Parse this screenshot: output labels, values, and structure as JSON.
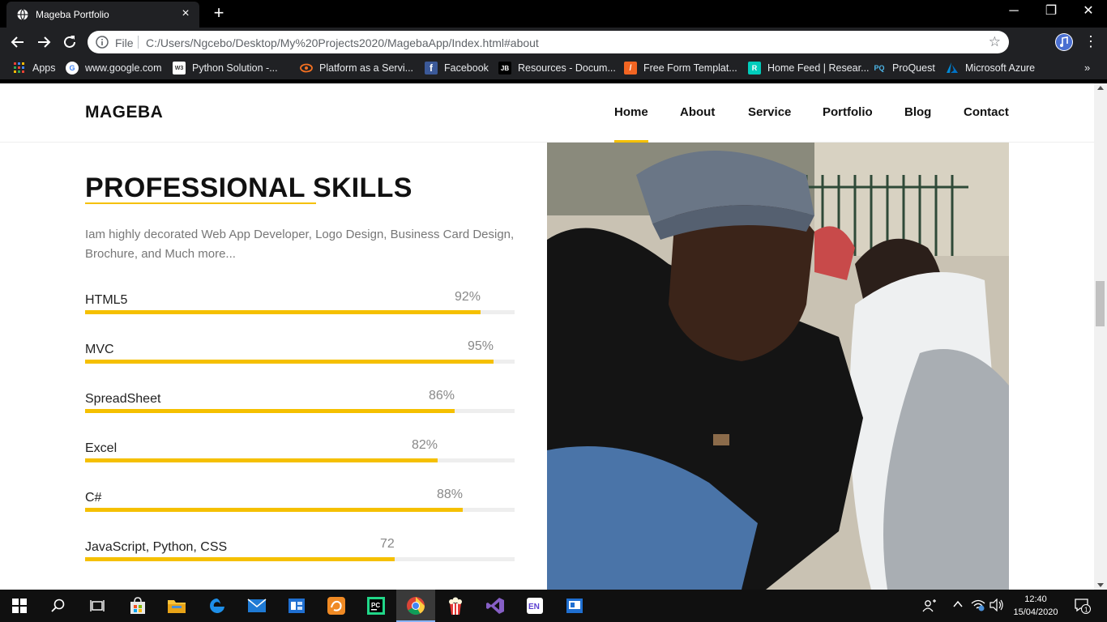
{
  "browser": {
    "tab_title": "Mageba Portfolio",
    "tab_close": "×",
    "new_tab": "+",
    "window_controls": {
      "minimize": "─",
      "restore": "❐",
      "close": "✕"
    },
    "address": {
      "scheme_label": "File",
      "url": "C:/Users/Ngcebo/Desktop/My%20Projects2020/MagebaApp/Index.html#about"
    },
    "star": "☆",
    "more": "⋮",
    "bookmarks": [
      {
        "label": "Apps",
        "icon": "apps-grid-icon",
        "color": "#ea4335"
      },
      {
        "label": "www.google.com",
        "icon": "google-icon",
        "color": "#ffffff"
      },
      {
        "label": "Python  Solution -...",
        "icon": "w3-icon",
        "color": "#ffffff"
      },
      {
        "label": "Platform as a Servi...",
        "icon": "eye-icon",
        "color": "#f37021"
      },
      {
        "label": "Facebook",
        "icon": "facebook-icon",
        "color": "#3b5998"
      },
      {
        "label": "Resources - Docum...",
        "icon": "jetbrains-icon",
        "color": "#202124"
      },
      {
        "label": "Free Form Templat...",
        "icon": "form-icon",
        "color": "#f26522"
      },
      {
        "label": "Home Feed | Resear...",
        "icon": "researchgate-icon",
        "color": "#00ccbb"
      },
      {
        "label": "ProQuest",
        "icon": "proquest-icon",
        "color": "#202124"
      },
      {
        "label": "Microsoft Azure",
        "icon": "azure-icon",
        "color": "#0089d6"
      }
    ],
    "bookmarks_overflow": "»"
  },
  "site": {
    "brand": "MAGEBA",
    "nav": [
      "Home",
      "About",
      "Service",
      "Portfolio",
      "Blog",
      "Contact"
    ],
    "active_nav": "Home",
    "accent_color": "#f5c000"
  },
  "skills_section": {
    "title": "PROFESSIONAL SKILLS",
    "intro": "Iam highly decorated Web App Developer, Logo Design, Business Card Design, Brochure, and Much more...",
    "skills": [
      {
        "name": "HTML5",
        "label": "92%",
        "value": 0.92
      },
      {
        "name": "MVC",
        "label": "95%",
        "value": 0.95
      },
      {
        "name": "SpreadSheet",
        "label": "86%",
        "value": 0.86
      },
      {
        "name": "Excel",
        "label": "82%",
        "value": 0.82
      },
      {
        "name": "C#",
        "label": "88%",
        "value": 0.88
      },
      {
        "name": "JavaScript, Python, CSS",
        "label": "72",
        "value": 0.72
      }
    ]
  },
  "taskbar": {
    "apps": [
      "start-icon",
      "search-icon",
      "task-view-icon",
      "store-icon",
      "file-explorer-icon",
      "edge-icon",
      "mail-icon",
      "app-icon",
      "uc-browser-icon",
      "pycharm-icon",
      "chrome-icon",
      "popcorn-icon",
      "visual-studio-icon",
      "en-dictionary-icon",
      "remote-desktop-icon"
    ],
    "active_app": "chrome-icon",
    "time": "12:40",
    "date": "15/04/2020",
    "notifications": "1"
  }
}
